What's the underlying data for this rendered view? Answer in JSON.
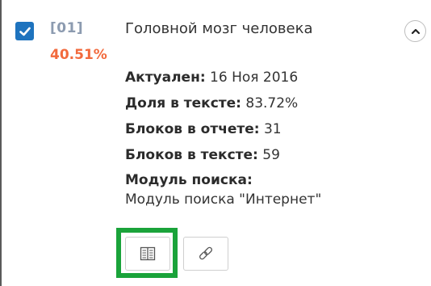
{
  "source": {
    "index": "[01]",
    "percent": "40.51%",
    "title": "Головной мозг человека",
    "checked": true
  },
  "details": {
    "actual_label": "Актуален:",
    "actual_value": "16 Ноя 2016",
    "share_label": "Доля в тексте:",
    "share_value": "83.72%",
    "blocks_report_label": "Блоков в отчете:",
    "blocks_report_value": "31",
    "blocks_text_label": "Блоков в тексте:",
    "blocks_text_value": "59",
    "module_label": "Модуль поиска:",
    "module_value": "Модуль поиска \"Интернет\""
  },
  "icons": {
    "checkbox": "checkmark-icon",
    "collapse": "chevron-up-icon",
    "source": "book-icon",
    "link": "link-icon"
  },
  "colors": {
    "checkbox": "#1e73be",
    "index": "#8c9bb0",
    "percent": "#f26a3d",
    "highlight": "#1aa33a"
  }
}
